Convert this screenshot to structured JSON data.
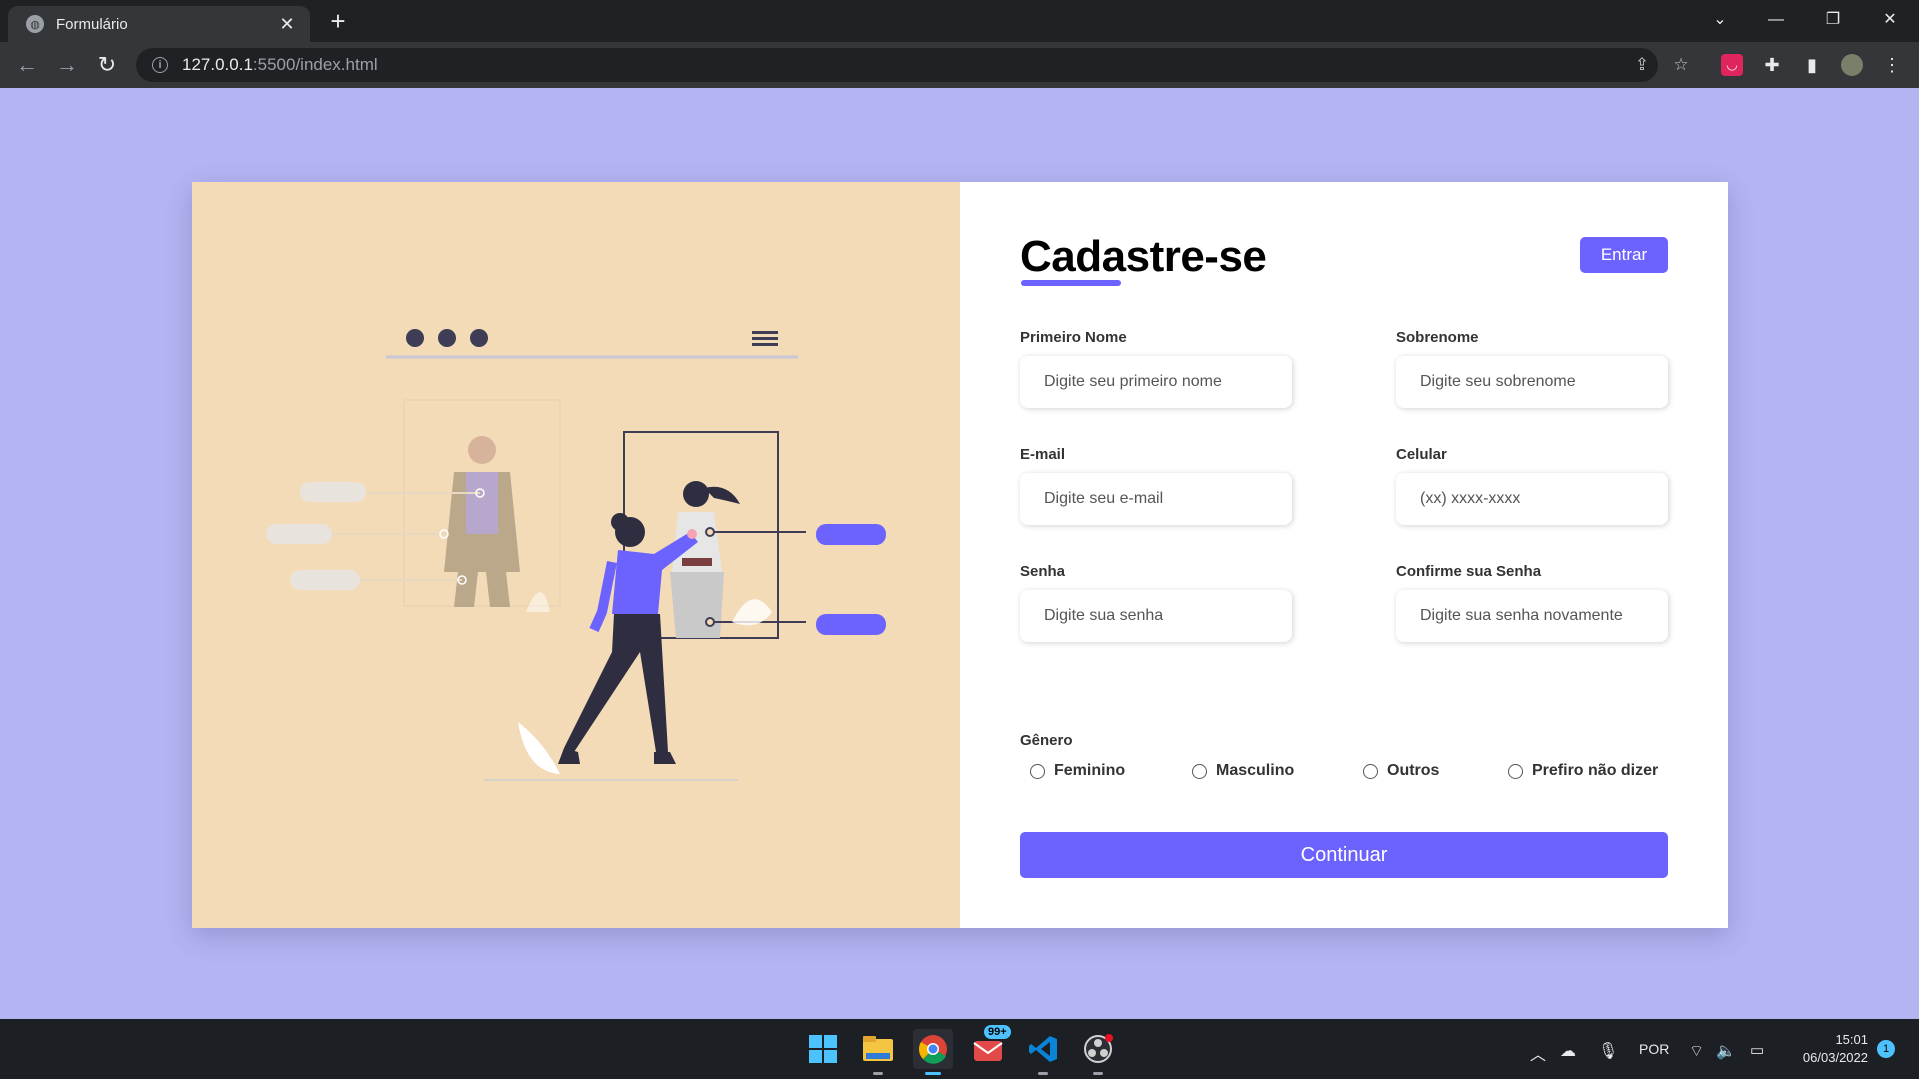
{
  "browser": {
    "tab_title": "Formulário",
    "tab_close": "✕",
    "new_tab": "+",
    "url_host": "127.0.0.1",
    "url_path": ":5500/index.html",
    "window_controls": {
      "chevron": "⌄",
      "minimize": "—",
      "restore": "❐",
      "close": "✕"
    }
  },
  "illustration": {
    "dots_count": 3,
    "accent_color": "#6c63ff",
    "bg_color": "#f2dbb6"
  },
  "form": {
    "title": "Cadastre-se",
    "login_label": "Entrar",
    "fields": [
      {
        "label": "Primeiro Nome",
        "placeholder": "Digite seu primeiro nome"
      },
      {
        "label": "Sobrenome",
        "placeholder": "Digite seu sobrenome"
      },
      {
        "label": "E-mail",
        "placeholder": "Digite seu e-mail"
      },
      {
        "label": "Celular",
        "placeholder": "(xx) xxxx-xxxx"
      },
      {
        "label": "Senha",
        "placeholder": "Digite sua senha"
      },
      {
        "label": "Confirme sua Senha",
        "placeholder": "Digite sua senha novamente"
      }
    ],
    "gender_label": "Gênero",
    "gender_options": [
      "Feminino",
      "Masculino",
      "Outros",
      "Prefiro não dizer"
    ],
    "continue_label": "Continuar"
  },
  "taskbar": {
    "mail_badge": "99+",
    "language": "POR",
    "time": "15:01",
    "date": "06/03/2022",
    "notification_count": "1"
  },
  "colors": {
    "page_bg": "#b3b4f2",
    "accent": "#6c63ff"
  }
}
